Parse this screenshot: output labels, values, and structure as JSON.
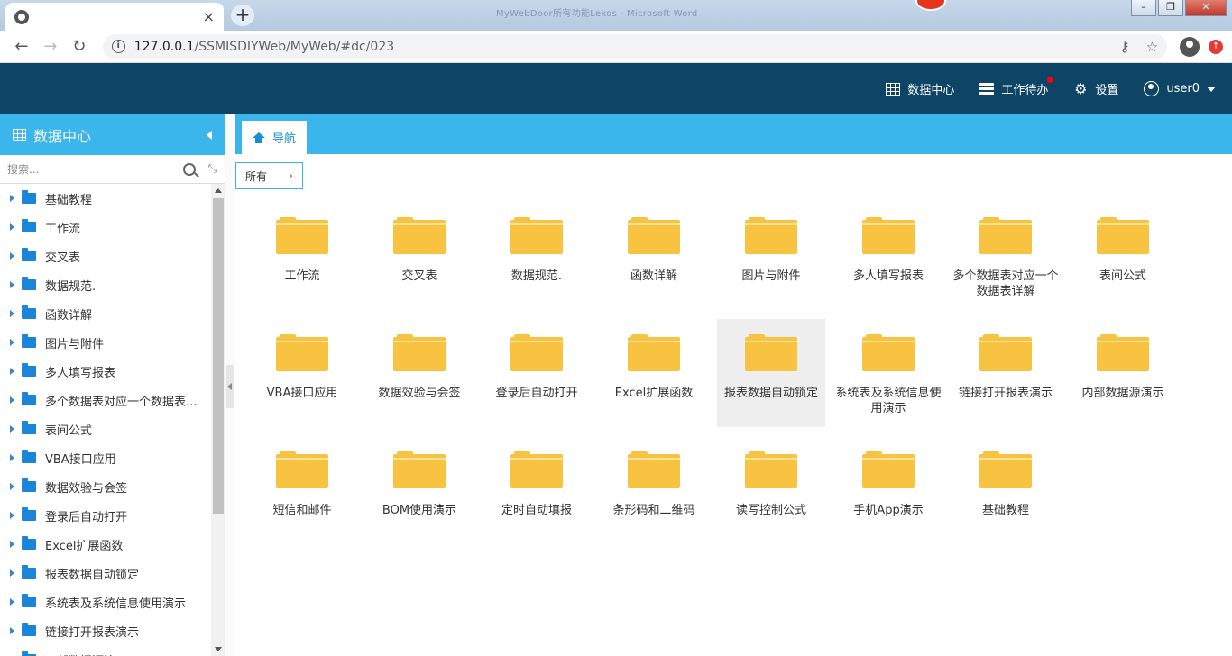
{
  "browser": {
    "tab_close": "×",
    "new_tab": "+",
    "window_title": "MyWebDoor所有功能Lekos  -  Microsoft Word",
    "url_host": "127.0.0.1",
    "url_path": "/SSMISDIYWeb/MyWeb/#dc/023",
    "back": "←",
    "forward": "→",
    "reload": "↻",
    "key_icon": "⚷",
    "star_icon": "☆",
    "more_icon": "⋮",
    "ext_icon": "↑"
  },
  "header": {
    "items": [
      {
        "label": "数据中心",
        "icon": "grid-icon"
      },
      {
        "label": "工作待办",
        "icon": "tray-icon",
        "badge": true
      },
      {
        "label": "设置",
        "icon": "gear-icon"
      },
      {
        "label": "user0",
        "icon": "user-icon",
        "caret": true
      }
    ]
  },
  "sidebar": {
    "title": "数据中心",
    "search_placeholder": "搜索...",
    "shrink_icon": "⤡",
    "items": [
      {
        "label": "基础教程"
      },
      {
        "label": "工作流"
      },
      {
        "label": "交叉表"
      },
      {
        "label": "数据规范."
      },
      {
        "label": "函数详解"
      },
      {
        "label": "图片与附件"
      },
      {
        "label": "多人填写报表"
      },
      {
        "label": "多个数据表对应一个数据表..."
      },
      {
        "label": "表间公式"
      },
      {
        "label": "VBA接口应用"
      },
      {
        "label": "数据效验与会签"
      },
      {
        "label": "登录后自动打开"
      },
      {
        "label": "Excel扩展函数"
      },
      {
        "label": "报表数据自动锁定"
      },
      {
        "label": "系统表及系统信息使用演示"
      },
      {
        "label": "链接打开报表演示"
      },
      {
        "label": "内部数据源演示"
      }
    ]
  },
  "main": {
    "tab_label": "导航",
    "breadcrumb": "所有",
    "breadcrumb_chevron": "›",
    "folders": [
      {
        "label": "工作流"
      },
      {
        "label": "交叉表"
      },
      {
        "label": "数据规范."
      },
      {
        "label": "函数详解"
      },
      {
        "label": "图片与附件"
      },
      {
        "label": "多人填写报表"
      },
      {
        "label": "多个数据表对应一个数据表详解"
      },
      {
        "label": "表间公式"
      },
      {
        "label": "VBA接口应用"
      },
      {
        "label": "数据效验与会签"
      },
      {
        "label": "登录后自动打开"
      },
      {
        "label": "Excel扩展函数"
      },
      {
        "label": "报表数据自动锁定",
        "selected": true
      },
      {
        "label": "系统表及系统信息使用演示"
      },
      {
        "label": "链接打开报表演示"
      },
      {
        "label": "内部数据源演示"
      },
      {
        "label": "短信和邮件"
      },
      {
        "label": "BOM使用演示"
      },
      {
        "label": "定时自动填报"
      },
      {
        "label": "条形码和二维码"
      },
      {
        "label": "读写控制公式"
      },
      {
        "label": "手机App演示"
      },
      {
        "label": "基础教程"
      }
    ]
  },
  "colors": {
    "header_bg": "#0e4466",
    "accent": "#3bb6ec",
    "folder_yellow": "#f7c340",
    "tree_folder": "#1b86d9",
    "badge": "#ff0000"
  }
}
